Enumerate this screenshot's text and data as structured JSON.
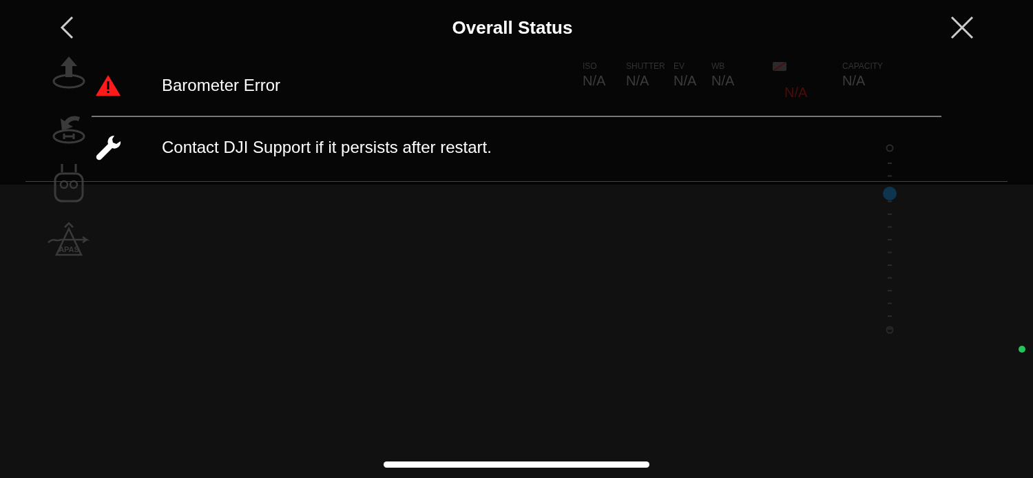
{
  "header": {
    "title": "Overall Status"
  },
  "messages": [
    {
      "kind": "warning",
      "text": "Barometer Error"
    },
    {
      "kind": "tip",
      "text": "Contact DJI Support if it persists after restart."
    }
  ],
  "background_hud": {
    "side_buttons": [
      {
        "kind": "takeoff"
      },
      {
        "kind": "return_home"
      },
      {
        "kind": "controller"
      },
      {
        "kind": "apas",
        "label": "APAS"
      }
    ],
    "camera_params": [
      {
        "kind": "text",
        "label": "ISO",
        "value": "N/A",
        "alert": false
      },
      {
        "kind": "text",
        "label": "SHUTTER",
        "value": "N/A",
        "alert": false
      },
      {
        "kind": "text",
        "label": "EV",
        "value": "N/A",
        "alert": false
      },
      {
        "kind": "text",
        "label": "WB",
        "value": "N/A",
        "alert": false
      },
      {
        "kind": "sd",
        "value": "N/A",
        "alert": true
      },
      {
        "kind": "text",
        "label": "CAPACITY",
        "value": "N/A",
        "alert": false
      }
    ],
    "zoom_slider": {
      "level": 0.75
    },
    "connection_dot": {
      "color": "#22c55e"
    }
  }
}
